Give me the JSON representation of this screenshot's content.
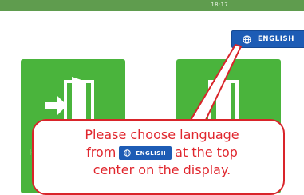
{
  "status_bar": {
    "time": "18:17"
  },
  "language_button": {
    "label": "ENGLISH",
    "icon": "globe-icon"
  },
  "tiles": [
    {
      "icon": "enter-door-icon",
      "label": "Id"
    },
    {
      "icon": "exit-door-icon"
    }
  ],
  "callout": {
    "line1": "Please choose language",
    "line2_before": "from",
    "inline_button_label": "ENGLISH",
    "line2_after": "at the top",
    "line3": "center on the display."
  },
  "colors": {
    "green": "#4ab43c",
    "button_blue": "#1d5cb5",
    "callout_red": "#e0262d"
  }
}
